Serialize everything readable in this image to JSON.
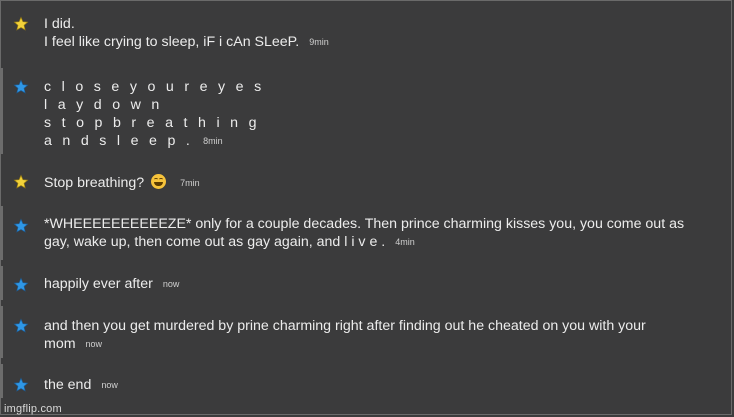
{
  "colors": {
    "background": "#3b3b3c",
    "star_yellow": "#f2d23a",
    "star_blue": "#2f97e6",
    "thread_bar": "#6c6c6c"
  },
  "messages": [
    {
      "star": "yellow",
      "lines": [
        "I did.",
        "I feel like crying to sleep, iF i cAn SLeeP."
      ],
      "time": "9min"
    },
    {
      "star": "blue",
      "lines": [
        "c l o s e y o u r e y e s",
        "l a y d o w n",
        "s t o p b r e a t h i n g",
        "a n d s l e e p ."
      ],
      "time": "8min"
    },
    {
      "star": "yellow",
      "lines": [
        "Stop breathing?"
      ],
      "emoji": "grinning-sweat-emoji",
      "time": "7min"
    },
    {
      "star": "blue",
      "lines": [
        "*WHEEEEEEEEEEZE* only for a couple decades. Then prince charming kisses you, you come out as",
        "gay, wake up, then come out as gay again, and l i v e ."
      ],
      "time": "4min"
    },
    {
      "star": "blue",
      "lines": [
        "happily ever after"
      ],
      "time": "now"
    },
    {
      "star": "blue",
      "lines": [
        "and then you get murdered by prine charming right after finding out he cheated on you with your",
        "mom"
      ],
      "time": "now"
    },
    {
      "star": "blue",
      "lines": [
        "the end"
      ],
      "time": "now"
    }
  ],
  "watermark": "imgflip.com"
}
